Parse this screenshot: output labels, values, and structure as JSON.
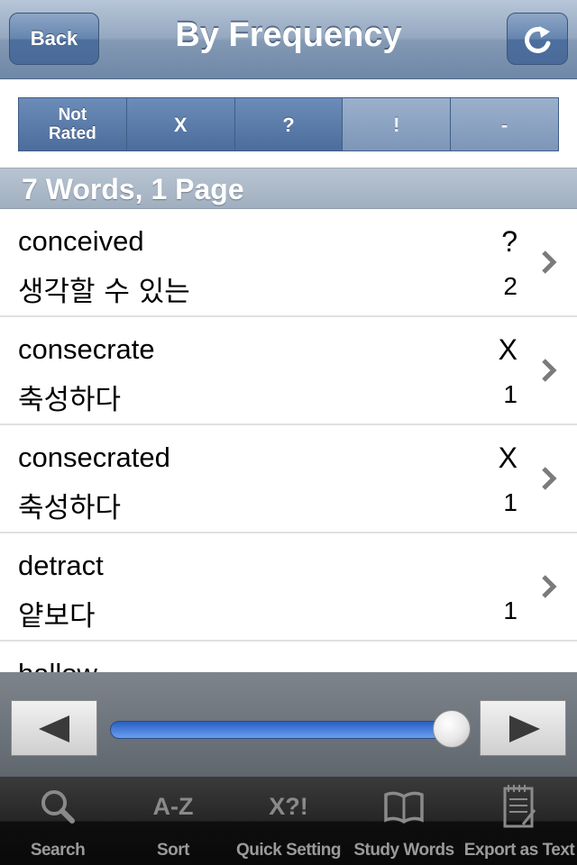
{
  "navbar": {
    "back_label": "Back",
    "title": "By Frequency",
    "refresh_icon": "refresh-icon"
  },
  "filters": [
    {
      "label_line1": "Not",
      "label_line2": "Rated",
      "selected": true
    },
    {
      "label": "X",
      "selected": true
    },
    {
      "label": "?",
      "selected": true
    },
    {
      "label": "!",
      "selected": false
    },
    {
      "label": "-",
      "selected": false
    }
  ],
  "section": {
    "header": "7 Words, 1 Page"
  },
  "words": [
    {
      "word": "conceived",
      "meaning": "생각할 수 있는",
      "rating": "?",
      "count": "2"
    },
    {
      "word": "consecrate",
      "meaning": "축성하다",
      "rating": "X",
      "count": "1"
    },
    {
      "word": "consecrated",
      "meaning": "축성하다",
      "rating": "X",
      "count": "1"
    },
    {
      "word": "detract",
      "meaning": "얕보다",
      "rating": "",
      "count": "1"
    },
    {
      "word": "hallow",
      "meaning": "",
      "rating": "",
      "count": ""
    }
  ],
  "pager": {
    "slider_position": 1.0,
    "prev_icon": "left-arrow-icon",
    "next_icon": "right-arrow-icon"
  },
  "tabs": [
    {
      "label": "Search",
      "icon": "search-icon"
    },
    {
      "label": "Sort",
      "icon_text": "A-Z"
    },
    {
      "label": "Quick Setting",
      "icon_text": "X?!"
    },
    {
      "label": "Study Words",
      "icon": "book-icon"
    },
    {
      "label": "Export as Text",
      "icon": "notepad-icon"
    }
  ],
  "colors": {
    "navbar": "#8399b4",
    "filter_selected": "#4c6d9c",
    "filter_unselected": "#8aa0c0",
    "slider": "#3c74d8"
  }
}
